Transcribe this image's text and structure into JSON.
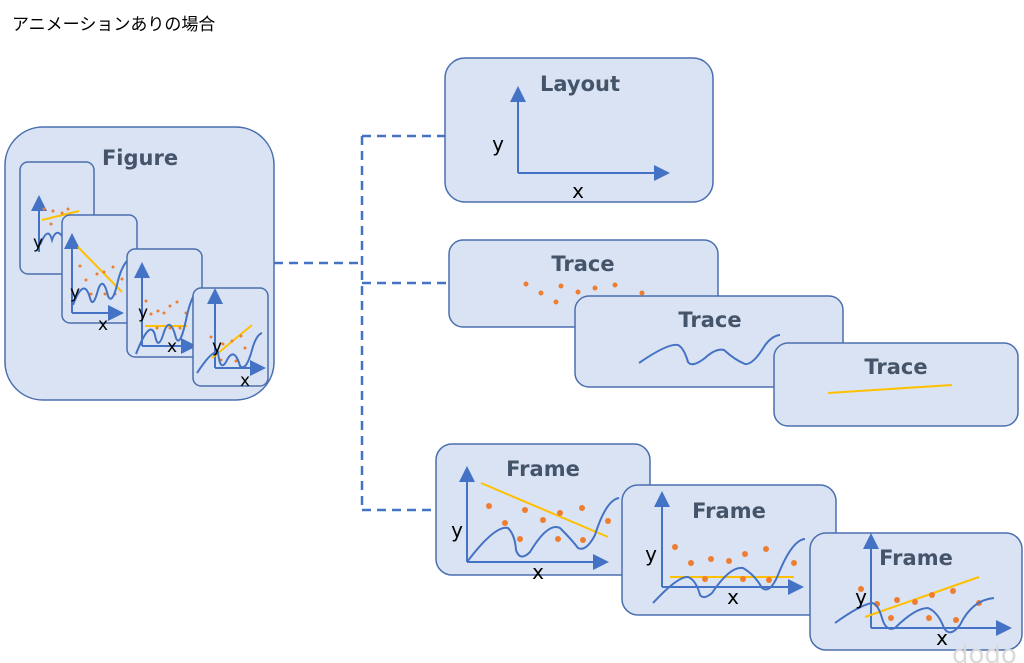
{
  "title": "アニメーションありの場合",
  "figure": {
    "label": "Figure"
  },
  "layout": {
    "label": "Layout"
  },
  "traces": [
    {
      "label": "Trace"
    },
    {
      "label": "Trace"
    },
    {
      "label": "Trace"
    }
  ],
  "frames": [
    {
      "label": "Frame"
    },
    {
      "label": "Frame"
    },
    {
      "label": "Frame"
    }
  ],
  "axes": {
    "y": "y",
    "x": "x"
  },
  "watermark": "dodo",
  "colors": {
    "box_fill": "#DAE3F3",
    "box_stroke": "#4A6FAF",
    "axis": "#4472C4",
    "line": "#FFC000",
    "dots": "#ED7D31",
    "label": "#44546A"
  }
}
